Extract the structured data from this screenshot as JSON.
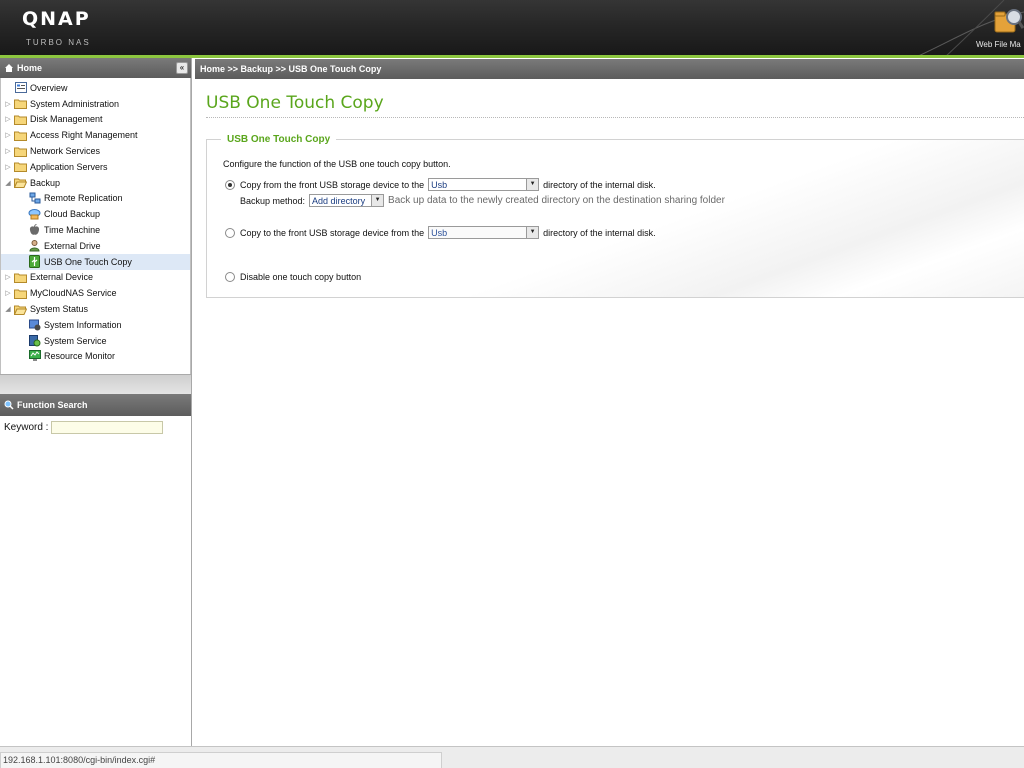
{
  "header": {
    "brand": "QNAP",
    "subtitle": "TURBO NAS",
    "web_file_manager": "Web File Ma"
  },
  "sidebar": {
    "home_label": "Home",
    "items": [
      {
        "label": "Overview",
        "level": 1,
        "icon": "overview-icon"
      },
      {
        "label": "System Administration",
        "level": 1,
        "icon": "folder-icon"
      },
      {
        "label": "Disk Management",
        "level": 1,
        "icon": "folder-icon"
      },
      {
        "label": "Access Right Management",
        "level": 1,
        "icon": "folder-icon"
      },
      {
        "label": "Network Services",
        "level": 1,
        "icon": "folder-icon"
      },
      {
        "label": "Application Servers",
        "level": 1,
        "icon": "folder-icon"
      },
      {
        "label": "Backup",
        "level": 1,
        "icon": "folder-open-icon"
      },
      {
        "label": "Remote Replication",
        "level": 2,
        "icon": "remote-replication-icon"
      },
      {
        "label": "Cloud Backup",
        "level": 2,
        "icon": "cloud-backup-icon"
      },
      {
        "label": "Time Machine",
        "level": 2,
        "icon": "apple-icon"
      },
      {
        "label": "External Drive",
        "level": 2,
        "icon": "external-drive-icon"
      },
      {
        "label": "USB One Touch Copy",
        "level": 2,
        "icon": "usb-icon",
        "selected": true
      },
      {
        "label": "External Device",
        "level": 1,
        "icon": "folder-icon"
      },
      {
        "label": "MyCloudNAS Service",
        "level": 1,
        "icon": "folder-icon"
      },
      {
        "label": "System Status",
        "level": 1,
        "icon": "folder-open-icon"
      },
      {
        "label": "System Information",
        "level": 2,
        "icon": "system-information-icon"
      },
      {
        "label": "System Service",
        "level": 2,
        "icon": "system-service-icon"
      },
      {
        "label": "Resource Monitor",
        "level": 2,
        "icon": "resource-monitor-icon"
      }
    ],
    "function_search": {
      "title": "Function Search",
      "keyword_label": "Keyword :",
      "keyword_value": ""
    }
  },
  "breadcrumb": "Home >> Backup >> USB One Touch Copy",
  "main": {
    "title": "USB One Touch Copy",
    "section_title": "USB One Touch Copy",
    "description": "Configure the function of the USB one touch copy button.",
    "options": {
      "copy_from": {
        "label": "Copy from the front USB storage device to the",
        "select_value": "Usb",
        "suffix": "directory of the internal disk.",
        "checked": true
      },
      "backup_method": {
        "label": "Backup method:",
        "select_value": "Add directory",
        "hint": "Back up data to the newly created directory on the destination sharing folder"
      },
      "copy_to": {
        "label": "Copy to the front USB storage device from the",
        "select_value": "Usb",
        "suffix": "directory of the internal disk.",
        "checked": false
      },
      "disable": {
        "label": "Disable one touch copy button",
        "checked": false
      }
    }
  },
  "status_bar": {
    "url": "192.168.1.101:8080/cgi-bin/index.cgi#"
  },
  "colors": {
    "accent_green": "#5aa61c",
    "header_line": "#8cc63f",
    "selection": "#dde8f6"
  }
}
